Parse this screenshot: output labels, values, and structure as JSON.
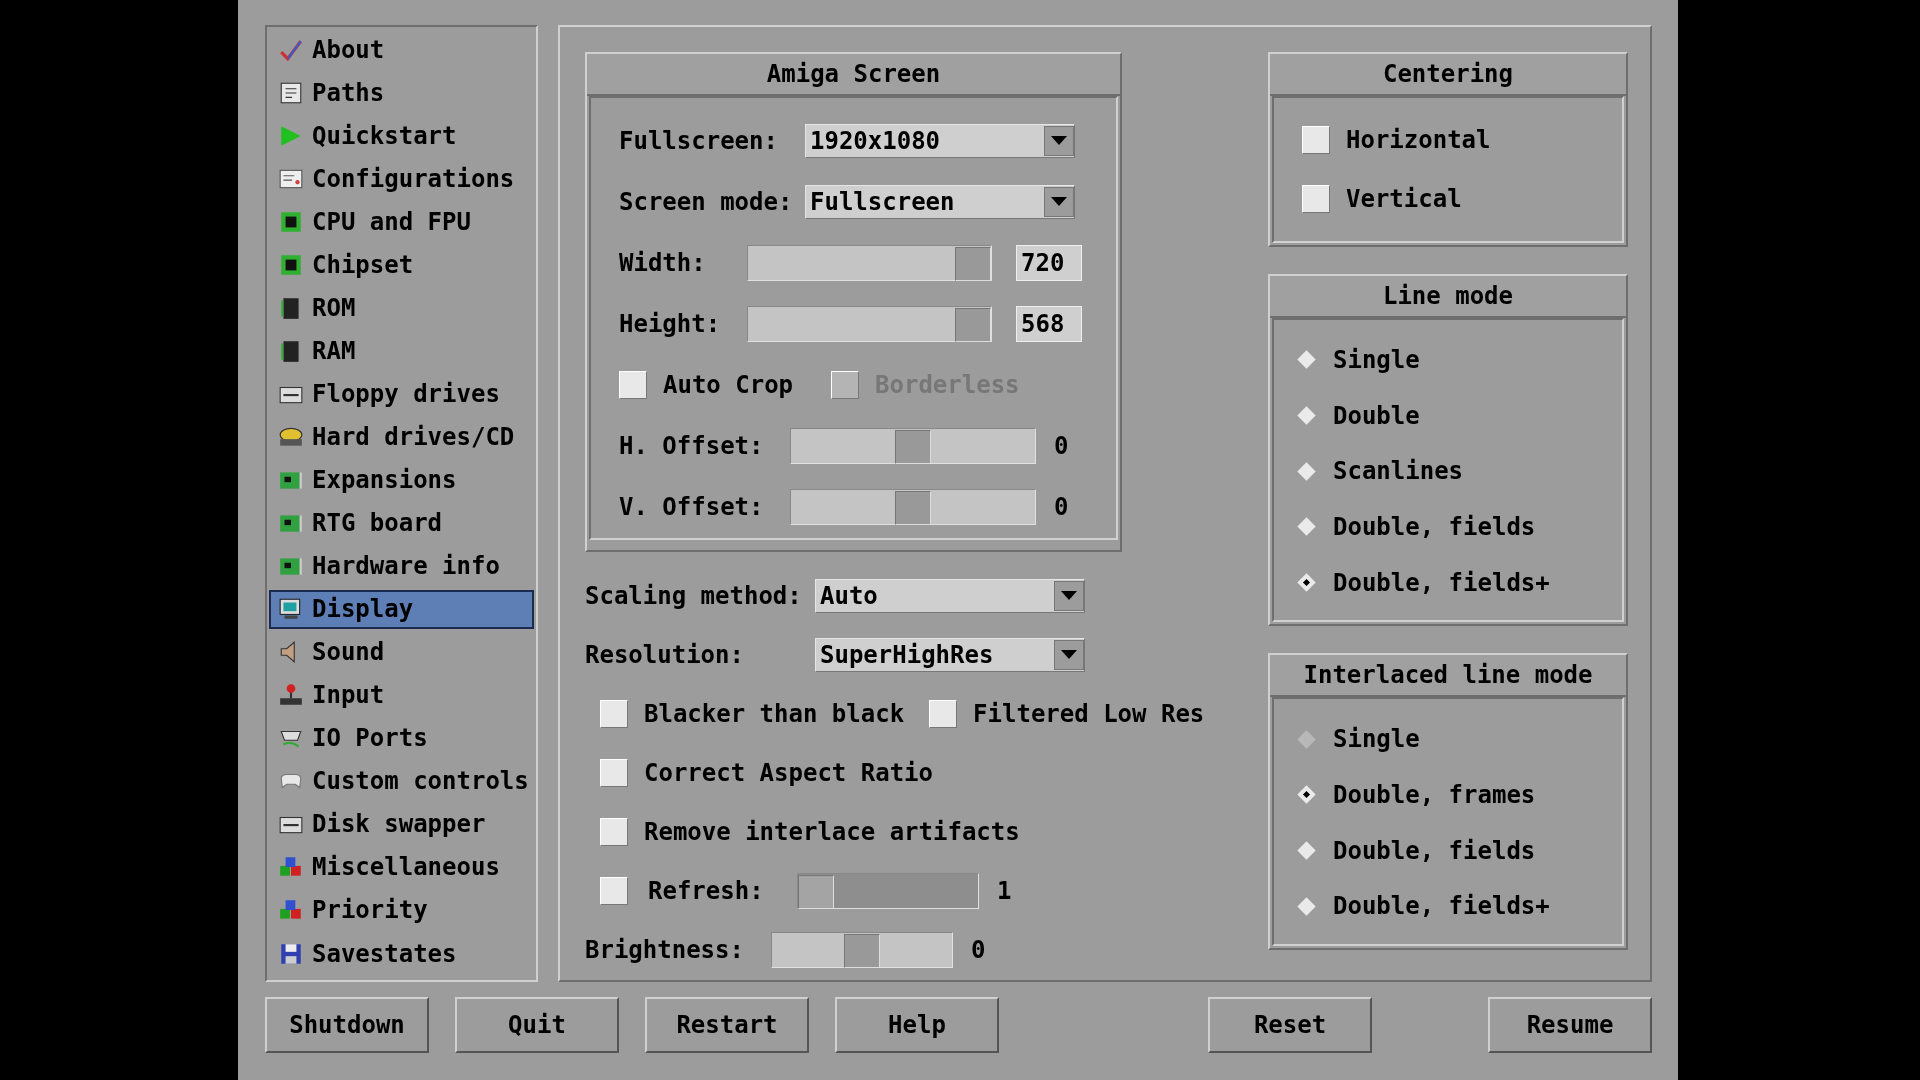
{
  "sidebar": {
    "items": [
      {
        "label": "About",
        "selected": false
      },
      {
        "label": "Paths",
        "selected": false
      },
      {
        "label": "Quickstart",
        "selected": false
      },
      {
        "label": "Configurations",
        "selected": false
      },
      {
        "label": "CPU and FPU",
        "selected": false
      },
      {
        "label": "Chipset",
        "selected": false
      },
      {
        "label": "ROM",
        "selected": false
      },
      {
        "label": "RAM",
        "selected": false
      },
      {
        "label": "Floppy drives",
        "selected": false
      },
      {
        "label": "Hard drives/CD",
        "selected": false
      },
      {
        "label": "Expansions",
        "selected": false
      },
      {
        "label": "RTG board",
        "selected": false
      },
      {
        "label": "Hardware info",
        "selected": false
      },
      {
        "label": "Display",
        "selected": true
      },
      {
        "label": "Sound",
        "selected": false
      },
      {
        "label": "Input",
        "selected": false
      },
      {
        "label": "IO Ports",
        "selected": false
      },
      {
        "label": "Custom controls",
        "selected": false
      },
      {
        "label": "Disk swapper",
        "selected": false
      },
      {
        "label": "Miscellaneous",
        "selected": false
      },
      {
        "label": "Priority",
        "selected": false
      },
      {
        "label": "Savestates",
        "selected": false
      }
    ]
  },
  "amiga_screen": {
    "title": "Amiga Screen",
    "rows": [
      {
        "kind": "dropdown",
        "label": "Fullscreen:",
        "value": "1920x1080"
      },
      {
        "kind": "dropdown",
        "label": "Screen mode:",
        "value": "Fullscreen"
      },
      {
        "kind": "slider_box",
        "label": "Width:",
        "level": 1,
        "value": "720"
      },
      {
        "kind": "slider_box",
        "label": "Height:",
        "level": 1,
        "value": "568"
      },
      {
        "kind": "checks",
        "checks": [
          {
            "label": "Auto Crop",
            "checked": false,
            "disabled": false
          },
          {
            "label": "Borderless",
            "checked": false,
            "disabled": true
          }
        ]
      },
      {
        "kind": "slider",
        "label": "H. Offset:",
        "level": 0.5,
        "value": "0"
      },
      {
        "kind": "slider",
        "label": "V. Offset:",
        "level": 0.5,
        "value": "0"
      }
    ]
  },
  "options": {
    "rows": [
      {
        "kind": "dropdown",
        "label": "Scaling method:",
        "value": "Auto"
      },
      {
        "kind": "dropdown",
        "label": "Resolution:",
        "value": "SuperHighRes"
      },
      {
        "kind": "checks",
        "checks": [
          {
            "label": "Blacker than black",
            "checked": false,
            "disabled": false
          },
          {
            "label": "Filtered Low Res",
            "checked": false,
            "disabled": false
          }
        ]
      },
      {
        "kind": "checks",
        "checks": [
          {
            "label": "Correct Aspect Ratio",
            "checked": false,
            "disabled": false
          }
        ]
      },
      {
        "kind": "checks",
        "checks": [
          {
            "label": "Remove interlace artifacts",
            "checked": false,
            "disabled": false
          }
        ]
      },
      {
        "kind": "check_slider",
        "label": "Refresh:",
        "checked": false,
        "disabled": true,
        "level": 0,
        "value": "1"
      },
      {
        "kind": "slider",
        "label": "Brightness:",
        "level": 0.5,
        "value": "0"
      }
    ]
  },
  "centering": {
    "title": "Centering",
    "checks": [
      {
        "label": "Horizontal",
        "checked": false
      },
      {
        "label": "Vertical",
        "checked": false
      }
    ]
  },
  "line_mode": {
    "title": "Line mode",
    "options": [
      {
        "label": "Single",
        "selected": false,
        "disabled": false
      },
      {
        "label": "Double",
        "selected": false,
        "disabled": false
      },
      {
        "label": "Scanlines",
        "selected": false,
        "disabled": false
      },
      {
        "label": "Double, fields",
        "selected": false,
        "disabled": false
      },
      {
        "label": "Double, fields+",
        "selected": true,
        "disabled": false
      }
    ]
  },
  "interlaced_line_mode": {
    "title": "Interlaced line mode",
    "options": [
      {
        "label": "Single",
        "selected": false,
        "disabled": true
      },
      {
        "label": "Double, frames",
        "selected": true,
        "disabled": false
      },
      {
        "label": "Double, fields",
        "selected": false,
        "disabled": false
      },
      {
        "label": "Double, fields+",
        "selected": false,
        "disabled": false
      }
    ]
  },
  "buttons_left": [
    {
      "label": "Shutdown"
    },
    {
      "label": "Quit"
    },
    {
      "label": "Restart"
    },
    {
      "label": "Help"
    }
  ],
  "buttons_right": [
    {
      "label": "Reset"
    },
    {
      "label": "Resume"
    }
  ]
}
